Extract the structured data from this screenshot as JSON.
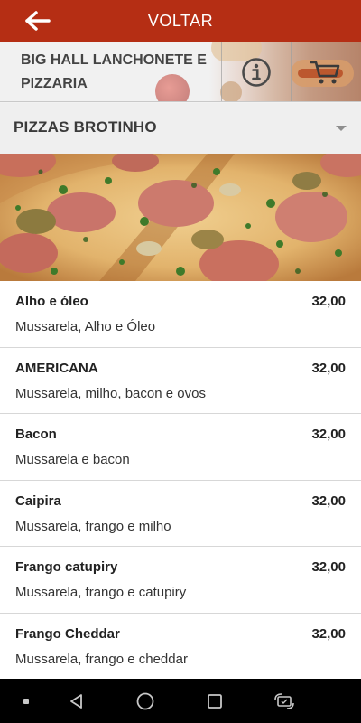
{
  "topbar": {
    "back_icon": "arrow-left-icon",
    "title": "VOLTAR"
  },
  "store": {
    "name": "BIG HALL LANCHONETE E PIZZARIA",
    "info_icon": "info-icon",
    "cart_icon": "cart-icon"
  },
  "category": {
    "selected": "PIZZAS BROTINHO",
    "icon": "chevron-down-icon"
  },
  "menu": {
    "items": [
      {
        "name": "Alho e óleo",
        "price": "32,00",
        "description": "Mussarela, Alho e Óleo"
      },
      {
        "name": "AMERICANA",
        "price": "32,00",
        "description": "Mussarela, milho, bacon e ovos"
      },
      {
        "name": "Bacon",
        "price": "32,00",
        "description": "Mussarela e bacon"
      },
      {
        "name": "Caipira",
        "price": "32,00",
        "description": "Mussarela, frango e milho"
      },
      {
        "name": "Frango catupiry",
        "price": "32,00",
        "description": "Mussarela, frango e catupiry"
      },
      {
        "name": "Frango Cheddar",
        "price": "32,00",
        "description": "Mussarela, frango e cheddar"
      }
    ]
  },
  "navbar": {
    "icons": [
      "dot-icon",
      "back-triangle-icon",
      "home-circle-icon",
      "recents-square-icon",
      "rotate-screen-icon"
    ]
  },
  "colors": {
    "accent": "#b52e14",
    "background": "#f2f2f2"
  }
}
